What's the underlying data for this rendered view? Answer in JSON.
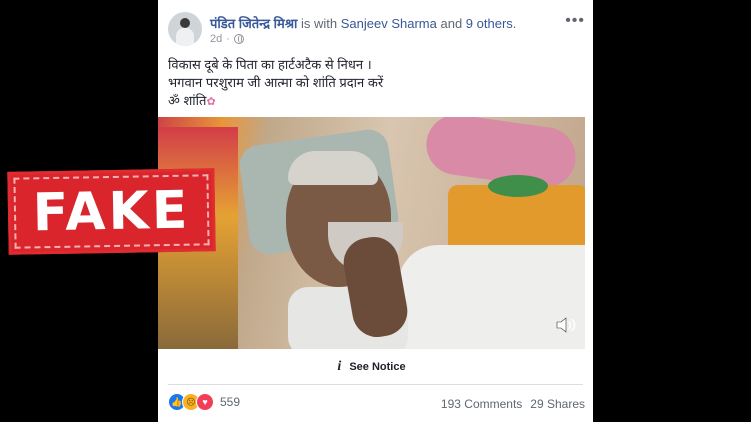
{
  "post": {
    "author": "पंडित जितेन्द्र मिश्रा",
    "with_text": " is with ",
    "tagged": "Sanjeev Sharma",
    "and_text": " and ",
    "others": "9 others",
    "period": ".",
    "time": "2d",
    "lines": [
      "विकास दूबे के पिता का हार्टअटैक से निधन ।",
      "भगवान परशुराम जी आत्मा को शांति प्रदान करें",
      "ॐ शांति"
    ],
    "more_icon": "more-horizontal-icon",
    "privacy_icon": "globe-icon"
  },
  "video": {
    "notice_icon": "info-icon",
    "notice_label": "See Notice",
    "volume_icon": "speaker-muted-icon"
  },
  "footer": {
    "reactions": [
      "like",
      "sad",
      "love"
    ],
    "reaction_count": "559",
    "comments": "193 Comments",
    "shares": "29 Shares"
  },
  "stamp": {
    "label": "FAKE",
    "color": "#d9252b"
  }
}
